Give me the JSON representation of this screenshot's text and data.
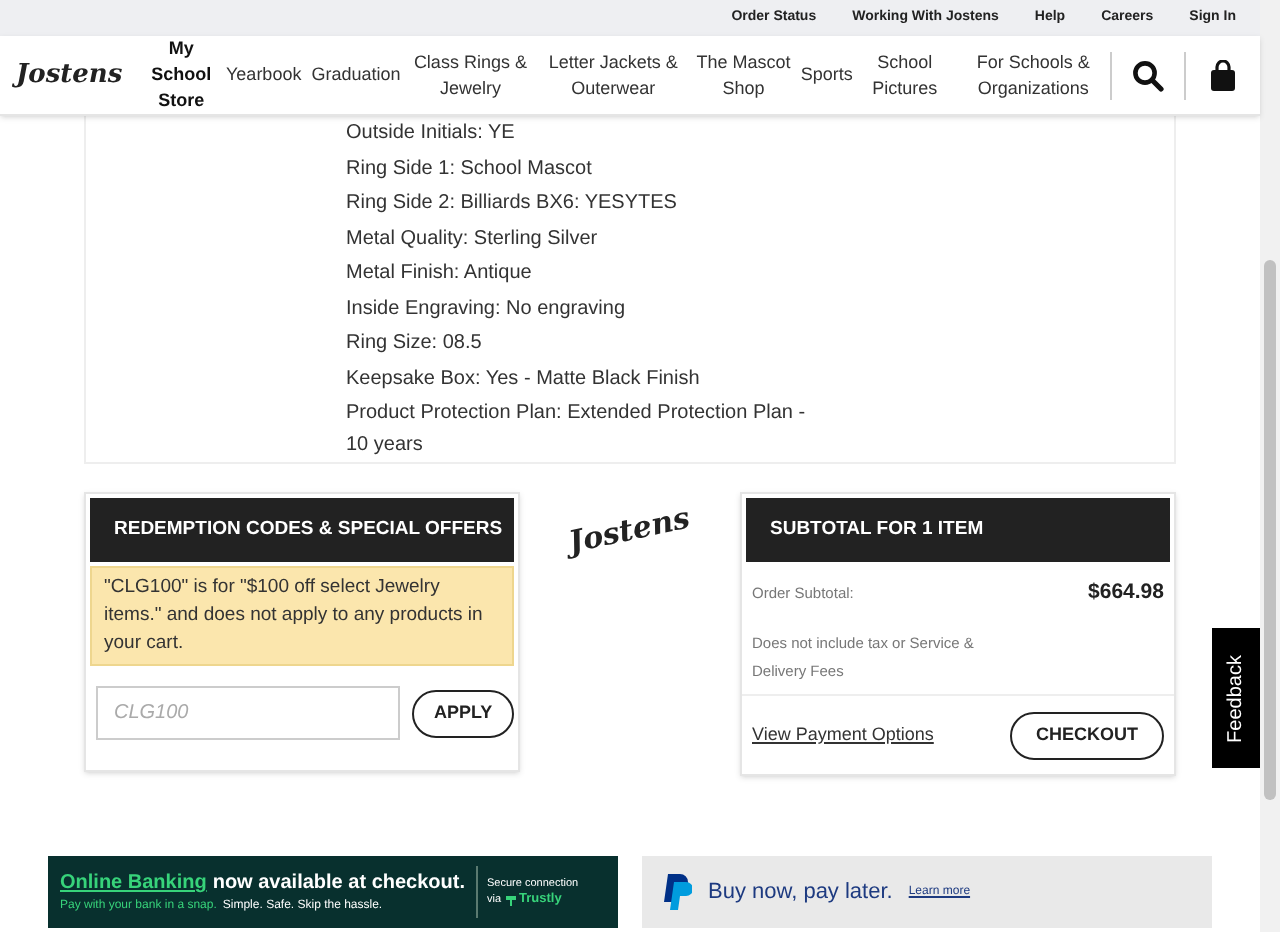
{
  "utility_links": [
    "Order Status",
    "Working With Jostens",
    "Help",
    "Careers",
    "Sign In"
  ],
  "logo": "Jostens",
  "nav": [
    {
      "label": "My School Store",
      "selected": true
    },
    {
      "label": "Yearbook",
      "selected": false
    },
    {
      "label": "Graduation",
      "selected": false
    },
    {
      "label": "Class Rings & Jewelry",
      "selected": false
    },
    {
      "label": "Letter Jackets & Outerwear",
      "selected": false
    },
    {
      "label": "The Mascot Shop",
      "selected": false
    },
    {
      "label": "Sports",
      "selected": false
    },
    {
      "label": "School Pictures",
      "selected": false
    },
    {
      "label": "For Schools & Organizations",
      "selected": false
    }
  ],
  "item_details": [
    "Outside Initials: YE",
    "Ring Side 1: School Mascot",
    "Ring Side 2: Billiards BX6: YESYTES",
    "Metal Quality: Sterling Silver",
    "Metal Finish: Antique",
    "Inside Engraving: No engraving",
    "Ring Size: 08.5",
    "Keepsake Box: Yes - Matte Black Finish",
    "Product Protection Plan: Extended Protection Plan - 10 years"
  ],
  "redemption": {
    "title": "REDEMPTION CODES & SPECIAL OFFERS",
    "notice": "\"CLG100\" is for \"$100 off select Jewelry items.\" and does not apply to any products in your cart.",
    "code_field": {
      "placeholder": "CLG100"
    },
    "button": "APPLY"
  },
  "center_logo": "Jostens",
  "subtotal": {
    "title": "SUBTOTAL FOR 1 ITEM",
    "label": "Order Subtotal:",
    "amount": "$664.98",
    "note": "Does not include tax or Service & Delivery Fees",
    "link": "View Payment Options",
    "button": "CHECKOUT"
  },
  "feedback_tab": "Feedback",
  "trustly_banner": {
    "link": "Online Banking",
    "headline": "now available at checkout.",
    "tagline_green": "Pay with your bank in a snap.",
    "tagline": "Simple. Safe. Skip the hassle.",
    "secure_line": "Secure connection",
    "via": "via",
    "brand": "Trustly"
  },
  "paypal_banner": {
    "text": "Buy now, pay later.",
    "link": "Learn more"
  }
}
